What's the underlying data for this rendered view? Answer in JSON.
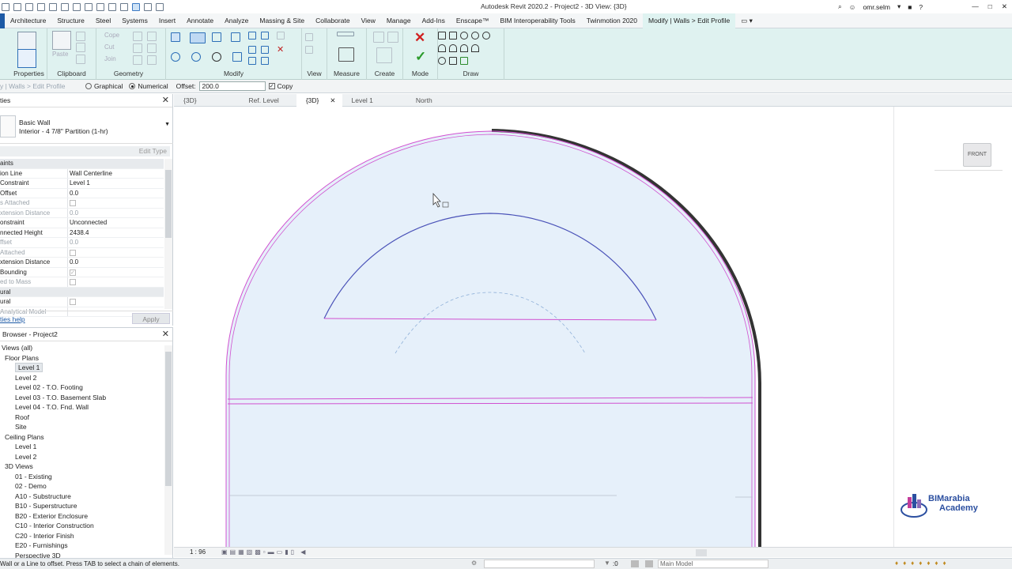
{
  "app": {
    "title": "Autodesk Revit 2020.2 - Project2 - 3D View: {3D}",
    "user": "omr.selm"
  },
  "ribbon_tabs": [
    {
      "label": "Architecture"
    },
    {
      "label": "Structure"
    },
    {
      "label": "Steel"
    },
    {
      "label": "Systems"
    },
    {
      "label": "Insert"
    },
    {
      "label": "Annotate"
    },
    {
      "label": "Analyze"
    },
    {
      "label": "Massing & Site"
    },
    {
      "label": "Collaborate"
    },
    {
      "label": "View"
    },
    {
      "label": "Manage"
    },
    {
      "label": "Add-Ins"
    },
    {
      "label": "Enscape™"
    },
    {
      "label": "BIM Interoperability Tools"
    },
    {
      "label": "Twinmotion 2020"
    },
    {
      "label": "Modify | Walls > Edit Profile",
      "selected": true
    }
  ],
  "ribbon_panels": {
    "properties": "Properties",
    "clipboard": "Clipboard",
    "geometry": "Geometry",
    "modify": "Modify",
    "view": "View",
    "measure": "Measure",
    "create": "Create",
    "mode": "Mode",
    "draw": "Draw",
    "paste": "Paste",
    "cope": "Cope",
    "cut": "Cut",
    "join": "Join"
  },
  "options_bar": {
    "context": "y | Walls > Edit Profile",
    "graphical": "Graphical",
    "numerical": "Numerical",
    "offset_label": "Offset:",
    "offset_value": "200.0",
    "copy_label": "Copy",
    "numerical_selected": true,
    "copy_checked": true
  },
  "properties": {
    "title": "ties",
    "type_family": "Basic Wall",
    "type_name": "Interior - 4 7/8\" Partition (1-hr)",
    "edit_type": "Edit Type",
    "help_link": "ties help",
    "apply": "Apply",
    "rows": [
      {
        "name": "aints",
        "value": "",
        "group": true
      },
      {
        "name": "ion Line",
        "value": "Wall Centerline"
      },
      {
        "name": "Constraint",
        "value": "Level 1"
      },
      {
        "name": "Offset",
        "value": "0.0"
      },
      {
        "name": "s Attached",
        "value": "",
        "check": true,
        "dim": true
      },
      {
        "name": "xtension Distance",
        "value": "0.0",
        "dim": true
      },
      {
        "name": "onstraint",
        "value": "Unconnected"
      },
      {
        "name": "nnected Height",
        "value": "2438.4"
      },
      {
        "name": "ffset",
        "value": "0.0",
        "dim": true
      },
      {
        "name": "Attached",
        "value": "",
        "check": true,
        "dim": true
      },
      {
        "name": "xtension Distance",
        "value": "0.0"
      },
      {
        "name": "Bounding",
        "value": "",
        "check": true,
        "checked": true
      },
      {
        "name": "ed to Mass",
        "value": "",
        "check": true,
        "dim": true
      },
      {
        "name": "ural",
        "value": "",
        "group": true
      },
      {
        "name": "ural",
        "value": "",
        "check": true
      },
      {
        "name": "Analytical Model",
        "value": "",
        "dim": true
      }
    ]
  },
  "browser": {
    "title": "Browser - Project2",
    "items": [
      {
        "label": "Views (all)",
        "indent": 0
      },
      {
        "label": "Floor Plans",
        "indent": 1
      },
      {
        "label": "Level 1",
        "indent": 2,
        "selected": true
      },
      {
        "label": "Level 2",
        "indent": 2
      },
      {
        "label": "Level 02 - T.O. Footing",
        "indent": 2
      },
      {
        "label": "Level 03 - T.O. Basement Slab",
        "indent": 2
      },
      {
        "label": "Level 04 - T.O. Fnd. Wall",
        "indent": 2
      },
      {
        "label": "Roof",
        "indent": 2
      },
      {
        "label": "Site",
        "indent": 2
      },
      {
        "label": "Ceiling Plans",
        "indent": 1
      },
      {
        "label": "Level 1",
        "indent": 2
      },
      {
        "label": "Level 2",
        "indent": 2
      },
      {
        "label": "3D Views",
        "indent": 1
      },
      {
        "label": "01 - Existing",
        "indent": 2
      },
      {
        "label": "02 - Demo",
        "indent": 2
      },
      {
        "label": "A10 - Substructure",
        "indent": 2
      },
      {
        "label": "B10 - Superstructure",
        "indent": 2
      },
      {
        "label": "B20 - Exterior Enclosure",
        "indent": 2
      },
      {
        "label": "C10 - Interior Construction",
        "indent": 2
      },
      {
        "label": "C20 - Interior Finish",
        "indent": 2
      },
      {
        "label": "E20 - Furnishings",
        "indent": 2
      },
      {
        "label": "Perspective 3D",
        "indent": 2
      }
    ]
  },
  "view_tabs": [
    {
      "label": "{3D}"
    },
    {
      "label": "Ref. Level"
    },
    {
      "label": "{3D}",
      "active": true
    },
    {
      "label": "Level 1"
    },
    {
      "label": "North"
    }
  ],
  "canvas": {
    "viewcube": "FRONT",
    "logo_line1": "BIMarabia",
    "logo_line2": "Academy",
    "colors": {
      "wall_fill": "#e6f0fa",
      "profile_line": "#d050d0",
      "arc_line": "#4a52b8",
      "dashed": "#8fb0d8"
    }
  },
  "view_bar": {
    "scale": "1 : 96"
  },
  "status": {
    "text": "Wall or a Line to offset. Press TAB to select a chain of elements.",
    "zero": ":0",
    "model": "Main Model"
  }
}
